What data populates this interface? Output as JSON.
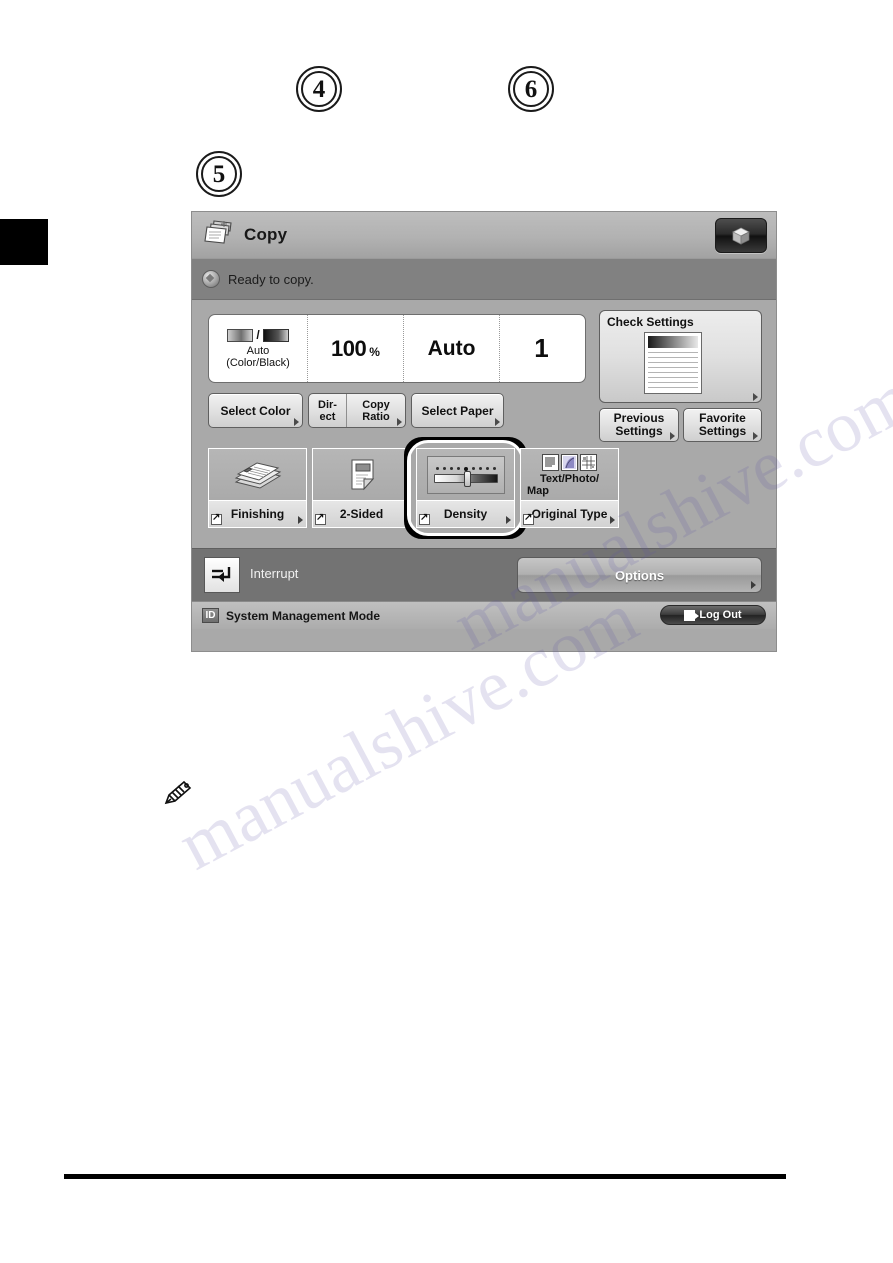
{
  "page": {
    "step_callouts": [
      {
        "number": "4"
      },
      {
        "number": "5"
      },
      {
        "number": "6"
      }
    ],
    "note_icon": "pencil-icon",
    "watermark_lines": [
      "manualshive.com",
      "manualshive.com"
    ]
  },
  "lcd": {
    "titlebar": {
      "icon": "copy-documents-icon",
      "title": "Copy",
      "right_button_icon": "cube-icon"
    },
    "status": {
      "icon": "status-indicator-icon",
      "message": "Ready to copy."
    },
    "summary": {
      "cells": [
        {
          "name": "color-mode",
          "swatch": "color-black-gradient-swatch",
          "label_line1": "Auto",
          "label_line2": "(Color/Black)"
        },
        {
          "name": "copy-ratio",
          "value": "100",
          "unit": "%"
        },
        {
          "name": "paper-size",
          "value": "Auto"
        },
        {
          "name": "copy-count",
          "value": "1"
        }
      ]
    },
    "setting_buttons": {
      "select_color": "Select Color",
      "direct_line1": "Dir-",
      "direct_line2": "ect",
      "copy_ratio_line1": "Copy",
      "copy_ratio_line2": "Ratio",
      "select_paper": "Select Paper"
    },
    "check_settings": {
      "title": "Check Settings",
      "thumbnail": "document-preview-thumbnail"
    },
    "memory_buttons": {
      "previous_line1": "Previous",
      "previous_line2": "Settings",
      "favorite_line1": "Favorite",
      "favorite_line2": "Settings"
    },
    "function_buttons": [
      {
        "name": "finishing",
        "label": "Finishing",
        "icon": "stapled-stack-icon",
        "highlighted": false
      },
      {
        "name": "two-sided",
        "label": "2-Sided",
        "icon": "two-sided-page-icon",
        "highlighted": false
      },
      {
        "name": "density",
        "label": "Density",
        "icon": "density-slider-icon",
        "highlighted": true
      },
      {
        "name": "original-type",
        "label": "Original Type",
        "value_line1": "Text/Photo/",
        "value_line2": "Map",
        "icon": "text-photo-map-icons",
        "highlighted": false
      }
    ],
    "interrupt_bar": {
      "icon": "interrupt-icon",
      "label": "Interrupt",
      "options_label": "Options"
    },
    "footer": {
      "id_badge": "ID",
      "mode_text": "System Management Mode",
      "logout_label": "Log Out",
      "logout_icon": "logout-arrow-icon"
    }
  },
  "colors": {
    "panel_bg": "#a9a9a9",
    "titlebar": "#b2b2b2",
    "status_bar": "#818181",
    "interrupt_bar": "#737373",
    "highlight_ring": "#000000",
    "accent_white": "#ffffff"
  }
}
